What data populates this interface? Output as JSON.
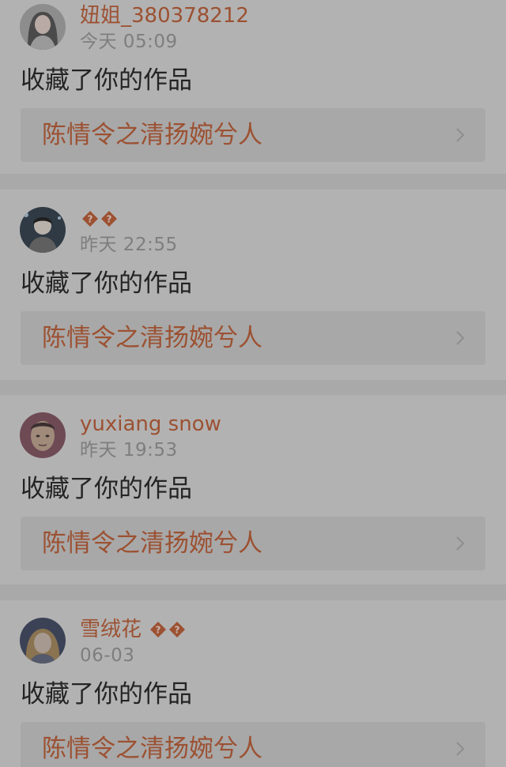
{
  "notifications": [
    {
      "user_name": "妞姐_380378212",
      "time": "今天 05:09",
      "action": "收藏了你的作品",
      "work_title": "陈情令之清扬婉兮人",
      "avatar_icon": "avatar-woman-long-hair",
      "badges": []
    },
    {
      "user_name": "",
      "time": "昨天 22:55",
      "action": "收藏了你的作品",
      "work_title": "陈情令之清扬婉兮人",
      "avatar_icon": "avatar-person-stage",
      "badges": [
        "replacement-char-icon",
        "replacement-char-icon"
      ]
    },
    {
      "user_name": "yuxiang snow",
      "time": "昨天 19:53",
      "action": "收藏了你的作品",
      "work_title": "陈情令之清扬婉兮人",
      "avatar_icon": "avatar-man-face",
      "badges": []
    },
    {
      "user_name": "雪绒花",
      "time": "06-03",
      "action": "收藏了你的作品",
      "work_title": "陈情令之清扬婉兮人",
      "avatar_icon": "avatar-child-portrait",
      "badges": [
        "replacement-char-icon",
        "replacement-char-icon"
      ]
    }
  ],
  "colors": {
    "page_background": "#a9a9a9",
    "card_background": "#b2b2b2",
    "link_background": "#a8a8a8",
    "accent": "#9c5132",
    "time_text": "#7e7e7e",
    "body_text": "#242424",
    "chevron": "#8e8e8e"
  },
  "icons": {
    "chevron": "chevron-right-icon",
    "badge": "replacement-char-icon"
  }
}
